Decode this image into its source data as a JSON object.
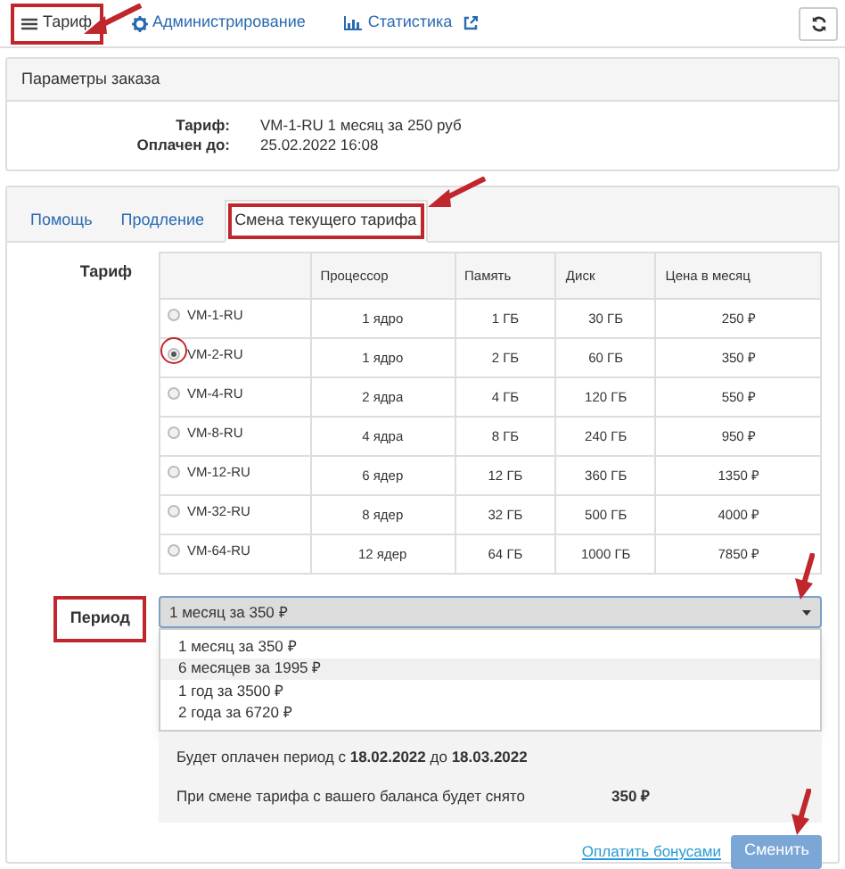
{
  "nav": [
    {
      "label": "Тариф",
      "selected": true,
      "annotated": true
    },
    {
      "label": "Администрирование",
      "selected": false,
      "annotated": false
    },
    {
      "label": "Статистика",
      "external": true,
      "selected": false,
      "annotated": false
    }
  ],
  "order_panel": {
    "title": "Параметры заказа",
    "rows": [
      {
        "label": "Тариф:",
        "value": "VM-1-RU 1 месяц за 250 руб"
      },
      {
        "label": "Оплачен до:",
        "value": "25.02.2022 16:08"
      }
    ]
  },
  "tabs": [
    {
      "label": "Помощь",
      "selected": false,
      "annotated": false
    },
    {
      "label": "Продление",
      "selected": false,
      "annotated": false
    },
    {
      "label": "Смена текущего тарифа",
      "selected": true,
      "annotated": true
    }
  ],
  "tariff": {
    "label": "Тариф",
    "columns": [
      "Процессор",
      "Память",
      "Диск",
      "Цена в месяц"
    ],
    "rows": [
      {
        "name": "VM-1-RU",
        "cpu": "1 ядро",
        "ram": "1 ГБ",
        "disk": "30 ГБ",
        "price": "250 ₽",
        "selected": false,
        "annotated": false
      },
      {
        "name": "VM-2-RU",
        "cpu": "1 ядро",
        "ram": "2 ГБ",
        "disk": "60 ГБ",
        "price": "350 ₽",
        "selected": true,
        "annotated": true
      },
      {
        "name": "VM-4-RU",
        "cpu": "2 ядра",
        "ram": "4 ГБ",
        "disk": "120 ГБ",
        "price": "550 ₽",
        "selected": false,
        "annotated": false
      },
      {
        "name": "VM-8-RU",
        "cpu": "4 ядра",
        "ram": "8 ГБ",
        "disk": "240 ГБ",
        "price": "950 ₽",
        "selected": false,
        "annotated": false
      },
      {
        "name": "VM-12-RU",
        "cpu": "6 ядер",
        "ram": "12 ГБ",
        "disk": "360 ГБ",
        "price": "1350 ₽",
        "selected": false,
        "annotated": false
      },
      {
        "name": "VM-32-RU",
        "cpu": "8 ядер",
        "ram": "32 ГБ",
        "disk": "500 ГБ",
        "price": "4000 ₽",
        "selected": false,
        "annotated": false
      },
      {
        "name": "VM-64-RU",
        "cpu": "12 ядер",
        "ram": "64 ГБ",
        "disk": "1000 ГБ",
        "price": "7850 ₽",
        "selected": false,
        "annotated": false
      }
    ]
  },
  "period": {
    "label": "Период",
    "label_annotated": true,
    "value": "1 месяц за 350 ₽",
    "expanded": true,
    "annotated": true,
    "options": [
      {
        "label": "1 месяц за 350 ₽",
        "highlighted": false
      },
      {
        "label": "6 месяцев за 1995 ₽",
        "highlighted": true
      },
      {
        "label": "1 год за 3500 ₽",
        "highlighted": false
      },
      {
        "label": "2 года за 6720 ₽",
        "highlighted": false
      }
    ]
  },
  "summary": {
    "period_text": "Будет оплачен период с **18.02.2022** до **18.03.2022**",
    "charge_label": "При смене тарифа с вашего баланса будет снято",
    "charge_value": "350 ₽"
  },
  "actions": {
    "link": "Оплатить бонусами",
    "button": "Сменить",
    "button_annotated": true
  }
}
